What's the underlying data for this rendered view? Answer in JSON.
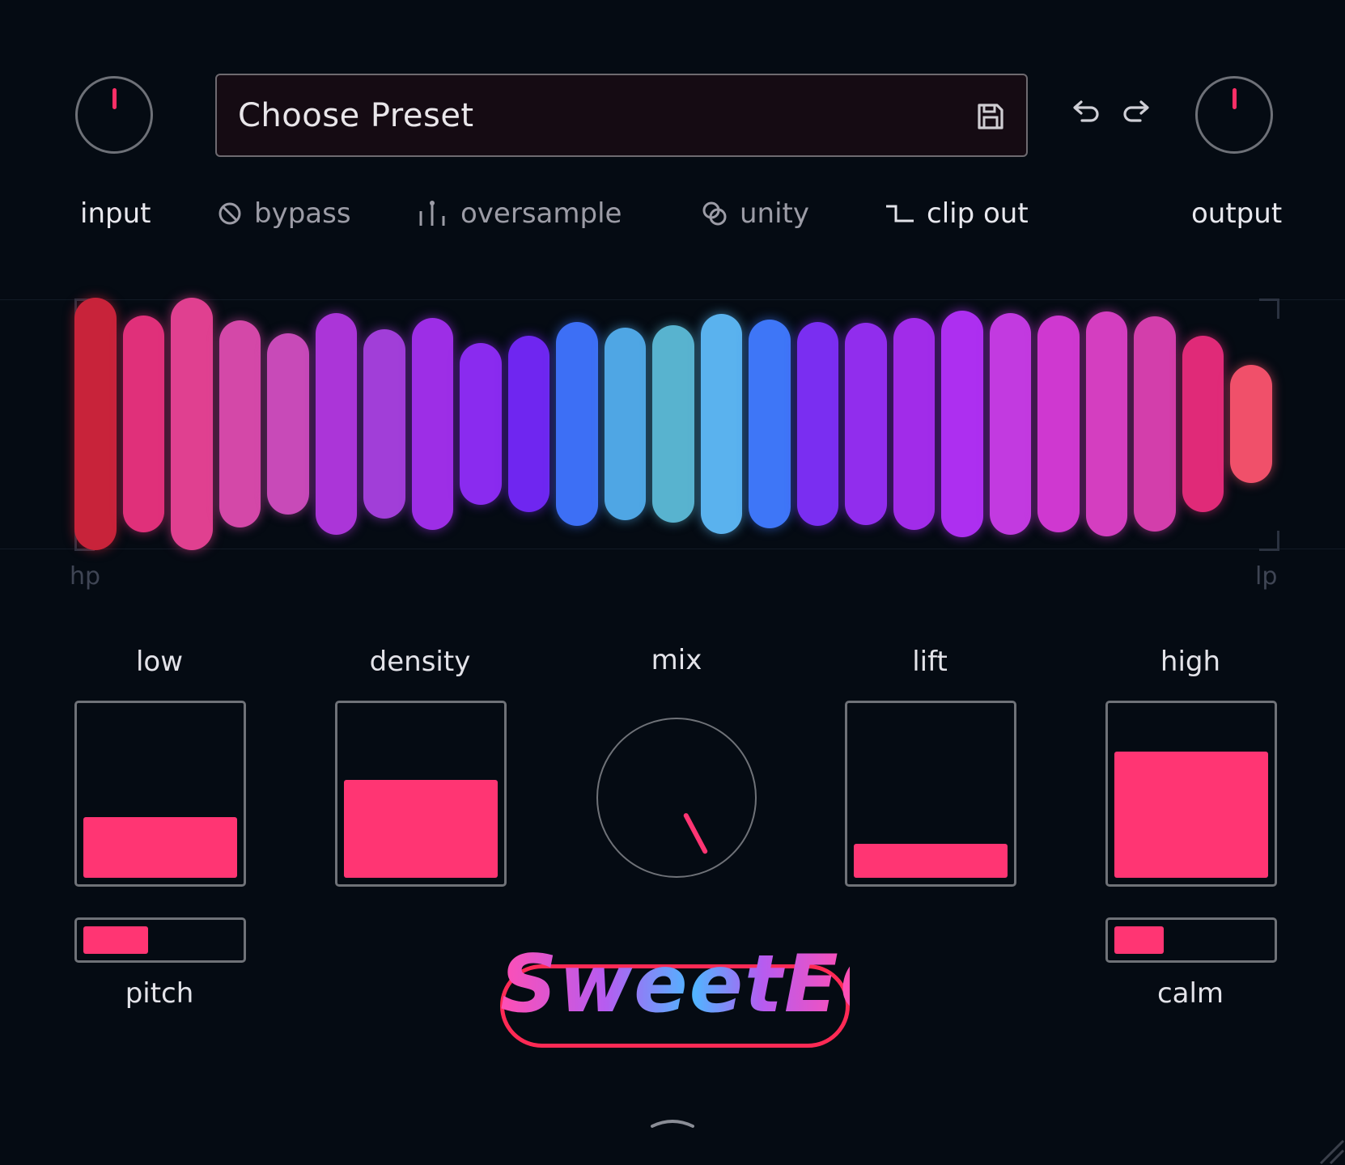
{
  "top": {
    "input_label": "input",
    "output_label": "output",
    "preset_placeholder": "Choose Preset",
    "icons": [
      "save-icon",
      "undo-icon",
      "redo-icon"
    ]
  },
  "toggles": {
    "bypass": "bypass",
    "oversample": "oversample",
    "unity": "unity",
    "clip_out": "clip out"
  },
  "eq": {
    "hp_label": "hp",
    "lp_label": "lp",
    "band_levels": [
      1.0,
      0.86,
      1.0,
      0.82,
      0.72,
      0.88,
      0.75,
      0.84,
      0.64,
      0.7,
      0.81,
      0.76,
      0.78,
      0.87,
      0.83,
      0.81,
      0.8,
      0.84,
      0.9,
      0.88,
      0.86,
      0.89,
      0.85,
      0.7,
      0.47
    ],
    "band_colors": [
      "#c8233a",
      "#e0307a",
      "#e04090",
      "#d448a8",
      "#c84ab8",
      "#ab35d8",
      "#a13ed8",
      "#9d2ee6",
      "#8a2bef",
      "#6f26f0",
      "#3d6ff5",
      "#4fa6e4",
      "#58b3cf",
      "#5ab2ee",
      "#3e76f7",
      "#7a2ef1",
      "#912ded",
      "#a12ce9",
      "#ad2ff0",
      "#c23ae0",
      "#cf38d0",
      "#d43ec0",
      "#d33eab",
      "#e02a78",
      "#f0506a"
    ]
  },
  "controls": {
    "low": {
      "label": "low",
      "level": 0.36
    },
    "density": {
      "label": "density",
      "level": 0.58
    },
    "mix": {
      "label": "mix",
      "angle_deg": 152
    },
    "lift": {
      "label": "lift",
      "level": 0.2
    },
    "high": {
      "label": "high",
      "level": 0.75
    },
    "pitch": {
      "label": "pitch",
      "level": 0.42
    },
    "calm": {
      "label": "calm",
      "level": 0.32
    }
  },
  "logo": {
    "text": "SweetEQ"
  },
  "colors": {
    "accent": "#ff3573",
    "background": "#050b13",
    "knob_outline": "#6f7278"
  }
}
